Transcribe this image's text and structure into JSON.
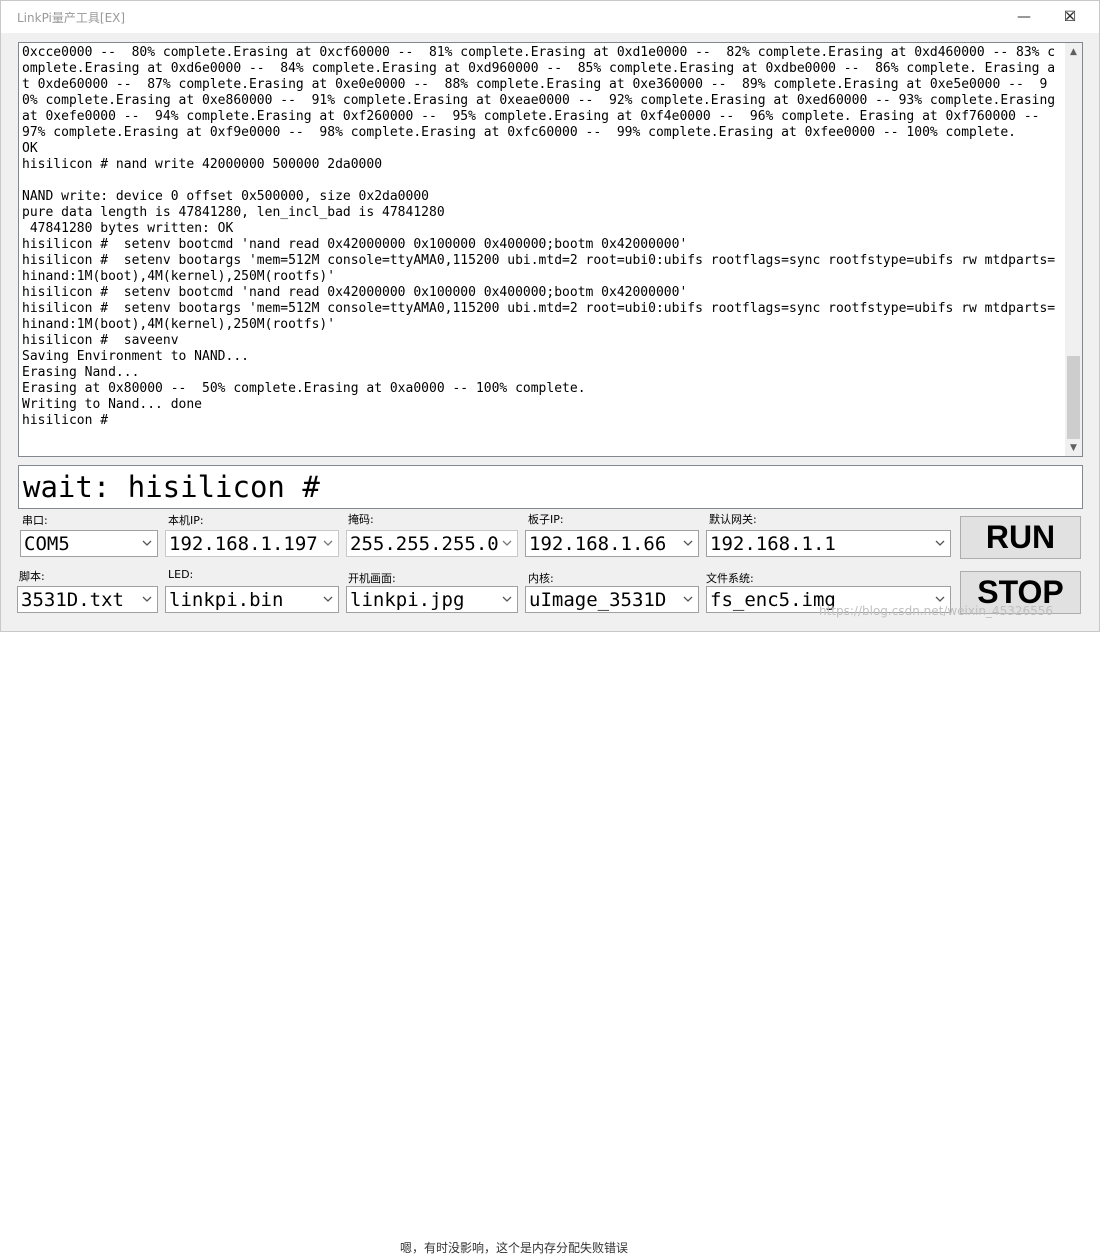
{
  "window": {
    "title": "LinkPi量产工具[EX]",
    "minimize_glyph": "—",
    "maximize_glyph": "☐",
    "close_glyph": "✕"
  },
  "console": {
    "text": "0xcce0000 --  80% complete.Erasing at 0xcf60000 --  81% complete.Erasing at 0xd1e0000 --  82% complete.Erasing at 0xd460000 -- 83% complete.Erasing at 0xd6e0000 --  84% complete.Erasing at 0xd960000 --  85% complete.Erasing at 0xdbe0000 --  86% complete. Erasing at 0xde60000 --  87% complete.Erasing at 0xe0e0000 --  88% complete.Erasing at 0xe360000 --  89% complete.Erasing at 0xe5e0000 --  90% complete.Erasing at 0xe860000 --  91% complete.Erasing at 0xeae0000 --  92% complete.Erasing at 0xed60000 -- 93% complete.Erasing at 0xefe0000 --  94% complete.Erasing at 0xf260000 --  95% complete.Erasing at 0xf4e0000 --  96% complete. Erasing at 0xf760000 --  97% complete.Erasing at 0xf9e0000 --  98% complete.Erasing at 0xfc60000 --  99% complete.Erasing at 0xfee0000 -- 100% complete.\nOK\nhisilicon # nand write 42000000 500000 2da0000\n\nNAND write: device 0 offset 0x500000, size 0x2da0000\npure data length is 47841280, len_incl_bad is 47841280\n 47841280 bytes written: OK\nhisilicon #  setenv bootcmd 'nand read 0x42000000 0x100000 0x400000;bootm 0x42000000'\nhisilicon #  setenv bootargs 'mem=512M console=ttyAMA0,115200 ubi.mtd=2 root=ubi0:ubifs rootflags=sync rootfstype=ubifs rw mtdparts=hinand:1M(boot),4M(kernel),250M(rootfs)'\nhisilicon #  setenv bootcmd 'nand read 0x42000000 0x100000 0x400000;bootm 0x42000000'\nhisilicon #  setenv bootargs 'mem=512M console=ttyAMA0,115200 ubi.mtd=2 root=ubi0:ubifs rootflags=sync rootfstype=ubifs rw mtdparts=hinand:1M(boot),4M(kernel),250M(rootfs)'\nhisilicon #  saveenv\nSaving Environment to NAND...\nErasing Nand...\nErasing at 0x80000 --  50% complete.Erasing at 0xa0000 -- 100% complete.\nWriting to Nand... done\nhisilicon #",
    "scroll_up_glyph": "▲",
    "scroll_down_glyph": "▼"
  },
  "command": {
    "value": "wait: hisilicon #"
  },
  "fields": {
    "serial": {
      "label": "串口:",
      "value": "COM5"
    },
    "local_ip": {
      "label": "本机IP:",
      "value": "192.168.1.197"
    },
    "mask": {
      "label": "掩码:",
      "value": "255.255.255.0"
    },
    "board_ip": {
      "label": "板子IP:",
      "value": "192.168.1.66"
    },
    "gateway": {
      "label": "默认网关:",
      "value": "192.168.1.1"
    },
    "script": {
      "label": "脚本:",
      "value": "3531D.txt"
    },
    "led": {
      "label": "LED:",
      "value": "linkpi.bin"
    },
    "boot_img": {
      "label": "开机画面:",
      "value": "linkpi.jpg"
    },
    "kernel": {
      "label": "内核:",
      "value": "uImage_3531D"
    },
    "fs": {
      "label": "文件系统:",
      "value": "fs_enc5.img"
    }
  },
  "buttons": {
    "run": "RUN",
    "stop": "STOP"
  },
  "background": {
    "text": "嗯，有时没影响，这个是内存分配失败错误",
    "watermark": "https://blog.csdn.net/weixin_45326556"
  },
  "colors": {
    "dropdown_arrow": "#555555",
    "disabled_arrow": "#a0a0a0"
  }
}
